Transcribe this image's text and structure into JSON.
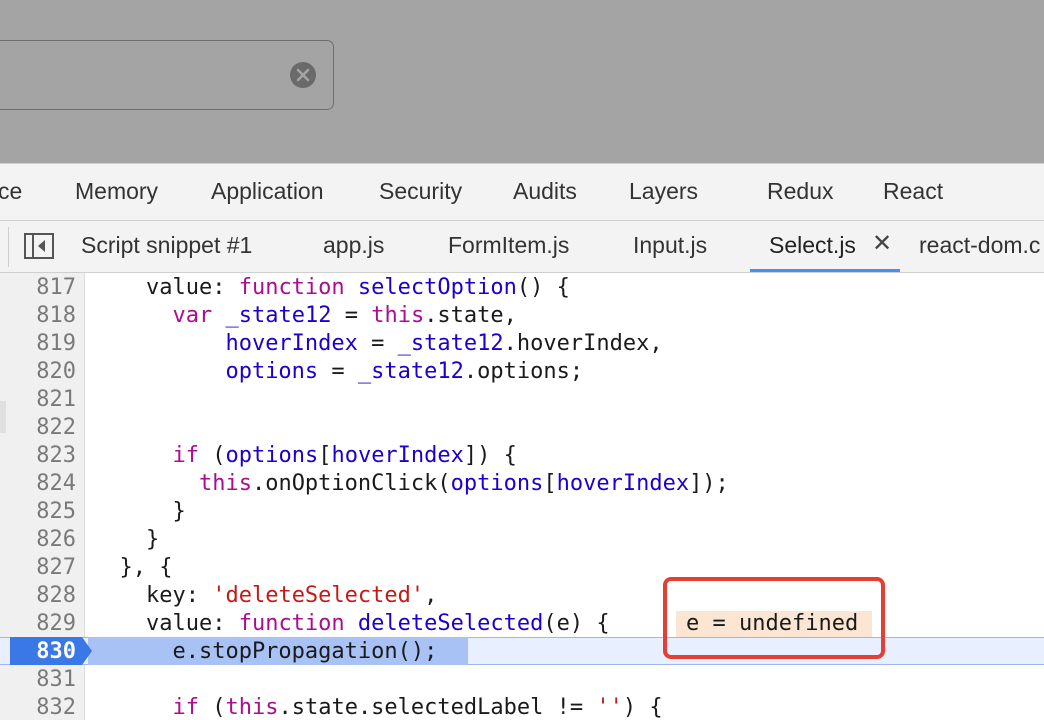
{
  "search": {
    "value": ""
  },
  "panel_tabs": [
    {
      "label": "ce"
    },
    {
      "label": "Memory"
    },
    {
      "label": "Application"
    },
    {
      "label": "Security"
    },
    {
      "label": "Audits"
    },
    {
      "label": "Layers"
    },
    {
      "label": "Redux"
    },
    {
      "label": "React"
    }
  ],
  "file_tabs": [
    {
      "label": "Script snippet #1"
    },
    {
      "label": "app.js"
    },
    {
      "label": "FormItem.js"
    },
    {
      "label": "Input.js"
    },
    {
      "label": "Select.js",
      "active": true
    },
    {
      "label": "react-dom.c"
    }
  ],
  "code_lines": [
    {
      "num": "817",
      "text": "    value: function selectOption() {"
    },
    {
      "num": "818",
      "text": "      var _state12 = this.state,"
    },
    {
      "num": "819",
      "text": "          hoverIndex = _state12.hoverIndex,"
    },
    {
      "num": "820",
      "text": "          options = _state12.options;"
    },
    {
      "num": "821",
      "text": ""
    },
    {
      "num": "822",
      "text": ""
    },
    {
      "num": "823",
      "text": "      if (options[hoverIndex]) {"
    },
    {
      "num": "824",
      "text": "        this.onOptionClick(options[hoverIndex]);"
    },
    {
      "num": "825",
      "text": "      }"
    },
    {
      "num": "826",
      "text": "    }"
    },
    {
      "num": "827",
      "text": "  }, {"
    },
    {
      "num": "828",
      "text": "    key: 'deleteSelected',"
    },
    {
      "num": "829",
      "text": "    value: function deleteSelected(e) {"
    },
    {
      "num": "830",
      "text": "      e.stopPropagation();"
    },
    {
      "num": "831",
      "text": ""
    },
    {
      "num": "832",
      "text": "      if (this.state.selectedLabel != '') {"
    }
  ],
  "inline_value": "e = undefined",
  "current_line": "830",
  "colors": {
    "keyword": "#aa0d91",
    "identifier": "#1c00cf",
    "string": "#c41a16",
    "exec_highlight": "#a9c2f5",
    "annotation_box": "#e53e33"
  }
}
